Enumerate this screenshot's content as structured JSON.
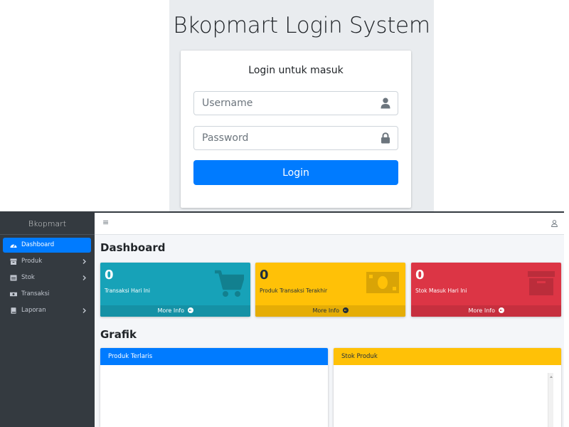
{
  "login": {
    "title": "Bkopmart Login System",
    "message": "Login untuk masuk",
    "username_placeholder": "Username",
    "password_placeholder": "Password",
    "button_label": "Login",
    "username_icon": "user-icon",
    "password_icon": "lock-icon",
    "button_color": "#007bff"
  },
  "sidebar": {
    "brand": "Bkopmart",
    "items": [
      {
        "label": "Dashboard",
        "icon": "tachometer-icon",
        "active": true,
        "has_submenu": false
      },
      {
        "label": "Produk",
        "icon": "box-icon",
        "active": false,
        "has_submenu": true
      },
      {
        "label": "Stok",
        "icon": "warehouse-icon",
        "active": false,
        "has_submenu": true
      },
      {
        "label": "Transaksi",
        "icon": "money-bill-icon",
        "active": false,
        "has_submenu": false
      },
      {
        "label": "Laporan",
        "icon": "book-icon",
        "active": false,
        "has_submenu": true
      }
    ]
  },
  "topbar": {
    "menu_icon": "hamburger-icon",
    "user_icon": "user-outline-icon"
  },
  "dashboard": {
    "title": "Dashboard",
    "boxes": [
      {
        "value": "0",
        "label": "Transaksi Hari Ini",
        "footer": "More Info",
        "icon": "shopping-cart-icon",
        "color": "#17a2b8"
      },
      {
        "value": "0",
        "label": "Produk Transaksi Terakhir",
        "footer": "More Info",
        "icon": "money-bill-icon",
        "color": "#ffc107"
      },
      {
        "value": "0",
        "label": "Stok Masuk Hari Ini",
        "footer": "More Info",
        "icon": "archive-icon",
        "color": "#dc3545"
      }
    ]
  },
  "grafik": {
    "title": "Grafik",
    "cards": [
      {
        "title": "Produk Terlaris",
        "color": "#007bff"
      },
      {
        "title": "Stok Produk",
        "color": "#ffc107"
      }
    ]
  }
}
